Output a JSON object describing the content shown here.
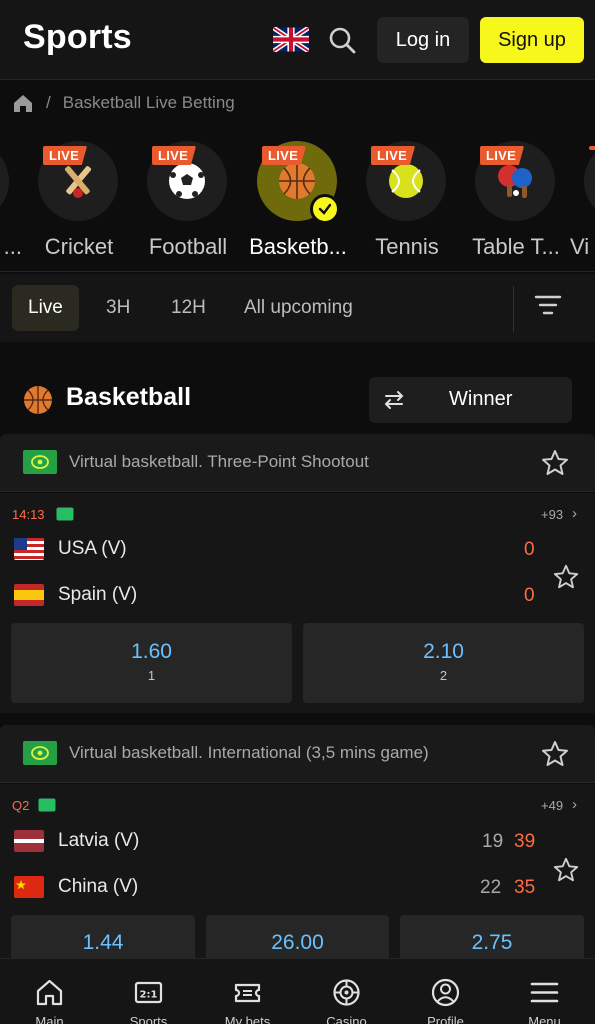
{
  "header": {
    "title": "Sports",
    "login_label": "Log in",
    "signup_label": "Sign up"
  },
  "breadcrumb": {
    "sep": "/",
    "current": "Basketball Live Betting"
  },
  "sports": [
    {
      "label": "...",
      "live_badge": "",
      "icon": "unknown-sport-icon"
    },
    {
      "label": "Cricket",
      "live_badge": "LIVE",
      "icon": "cricket-icon"
    },
    {
      "label": "Football",
      "live_badge": "LIVE",
      "icon": "football-icon"
    },
    {
      "label": "Basketb...",
      "live_badge": "LIVE",
      "icon": "basketball-icon",
      "selected": true
    },
    {
      "label": "Tennis",
      "live_badge": "LIVE",
      "icon": "tennis-icon"
    },
    {
      "label": "Table T...",
      "live_badge": "LIVE",
      "icon": "table-tennis-icon"
    },
    {
      "label": "Vi",
      "live_badge": "",
      "icon": "unknown-sport-icon"
    }
  ],
  "time_filters": [
    {
      "label": "Live",
      "active": true
    },
    {
      "label": "3H"
    },
    {
      "label": "12H"
    },
    {
      "label": "All upcoming"
    }
  ],
  "section": {
    "title": "Basketball",
    "market_label": "Winner"
  },
  "leagues": [
    {
      "name": "Virtual basketball. Three-Point Shootout",
      "match": {
        "time": "14:13",
        "more": "+93",
        "teams": [
          {
            "name": "USA (V)",
            "score": "0"
          },
          {
            "name": "Spain (V)",
            "score": "0"
          }
        ],
        "odds": [
          {
            "value": "1.60",
            "key": "1"
          },
          {
            "value": "2.10",
            "key": "2"
          }
        ]
      }
    },
    {
      "name": "Virtual basketball. International (3,5 mins game)",
      "match": {
        "time": "Q2",
        "more": "+49",
        "teams": [
          {
            "name": "Latvia (V)",
            "period_score": "19",
            "score": "39"
          },
          {
            "name": "China (V)",
            "period_score": "22",
            "score": "35"
          }
        ],
        "odds": [
          {
            "value": "1.44"
          },
          {
            "value": "26.00"
          },
          {
            "value": "2.75"
          }
        ]
      }
    }
  ],
  "bottom_nav": [
    {
      "label": "Main",
      "icon": "home-icon"
    },
    {
      "label": "Sports",
      "icon": "scoreboard-icon"
    },
    {
      "label": "My bets",
      "icon": "ticket-icon"
    },
    {
      "label": "Casino",
      "icon": "roulette-icon"
    },
    {
      "label": "Profile",
      "icon": "profile-icon"
    },
    {
      "label": "Menu",
      "icon": "hamburger-icon"
    }
  ],
  "colors": {
    "accent_yellow": "#f8f71c",
    "live_badge": "#ea5a2f",
    "odds_blue": "#6bc1ff",
    "score_red": "#ff6b45"
  }
}
